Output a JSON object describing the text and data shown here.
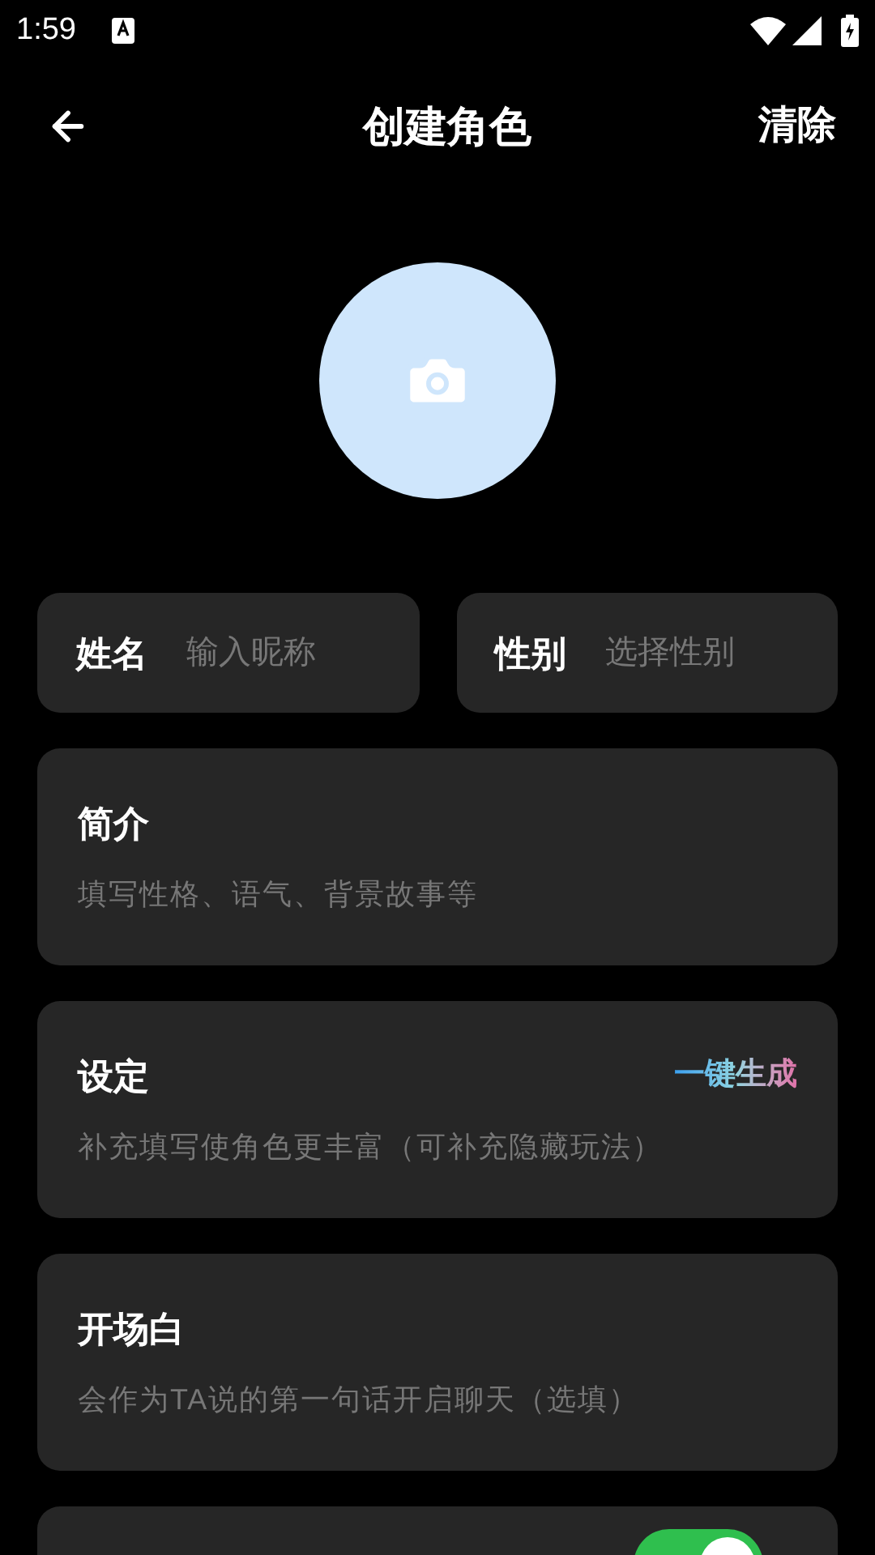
{
  "status_bar": {
    "time": "1:59"
  },
  "header": {
    "title": "创建角色",
    "action": "清除"
  },
  "fields": [
    {
      "label": "姓名",
      "placeholder": "输入昵称"
    },
    {
      "label": "性别",
      "placeholder": "选择性别"
    }
  ],
  "cards": [
    {
      "title": "简介",
      "placeholder": "填写性格、语气、背景故事等"
    },
    {
      "title": "设定",
      "placeholder": "补充填写使角色更丰富（可补充隐藏玩法）",
      "action": "一键生成"
    },
    {
      "title": "开场白",
      "placeholder": "会作为TA说的第一句话开启聊天（选填）"
    }
  ],
  "bottom_card": {
    "toggle_on": true
  }
}
